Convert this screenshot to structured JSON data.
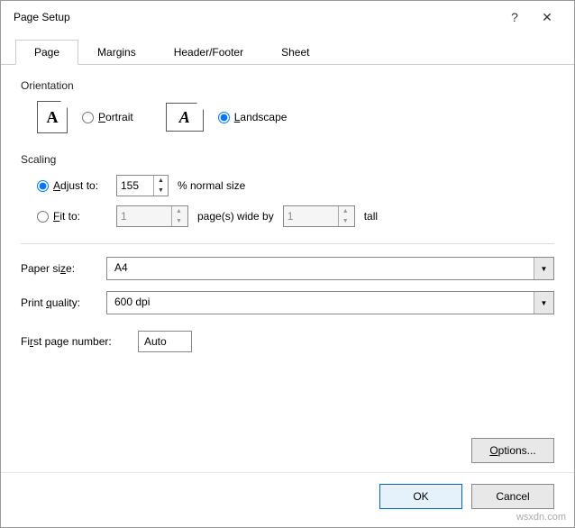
{
  "title": "Page Setup",
  "tabs": {
    "page": "Page",
    "margins": "Margins",
    "headerfooter": "Header/Footer",
    "sheet": "Sheet"
  },
  "orientation": {
    "label": "Orientation",
    "portrait": "Portrait",
    "landscape": "Landscape",
    "selected": "landscape"
  },
  "scaling": {
    "label": "Scaling",
    "adjust_label": "Adjust to:",
    "adjust_value": "155",
    "adjust_suffix": "% normal size",
    "fit_label": "Fit to:",
    "fit_wide": "1",
    "fit_mid": "page(s) wide by",
    "fit_tall": "1",
    "fit_suffix": "tall",
    "selected": "adjust"
  },
  "paper": {
    "label": "Paper size:",
    "value": "A4"
  },
  "quality": {
    "label": "Print quality:",
    "value": "600 dpi"
  },
  "firstpage": {
    "label": "First page number:",
    "value": "Auto"
  },
  "buttons": {
    "options": "Options...",
    "ok": "OK",
    "cancel": "Cancel"
  },
  "watermark": "wsxdn.com"
}
